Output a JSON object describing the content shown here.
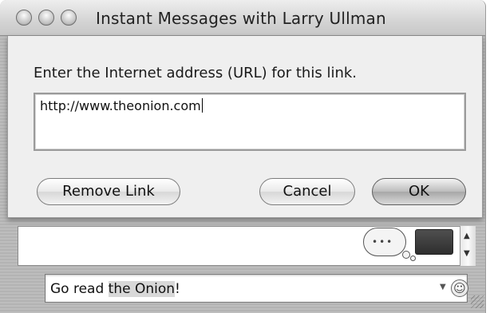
{
  "window": {
    "title": "Instant Messages with Larry Ullman"
  },
  "sheet": {
    "prompt": "Enter the Internet address (URL) for this link.",
    "url_value": "http://www.theonion.com",
    "buttons": {
      "remove_link": "Remove Link",
      "cancel": "Cancel",
      "ok": "OK"
    }
  },
  "compose": {
    "text_before": "Go read ",
    "text_link": "the Onion",
    "text_after": "!"
  },
  "icons": {
    "traffic_lights": [
      "close-icon",
      "minimize-icon",
      "zoom-icon"
    ],
    "typing": "typing-bubble-icon",
    "emoticon": "smiley-icon",
    "resize": "resize-grip-icon"
  }
}
